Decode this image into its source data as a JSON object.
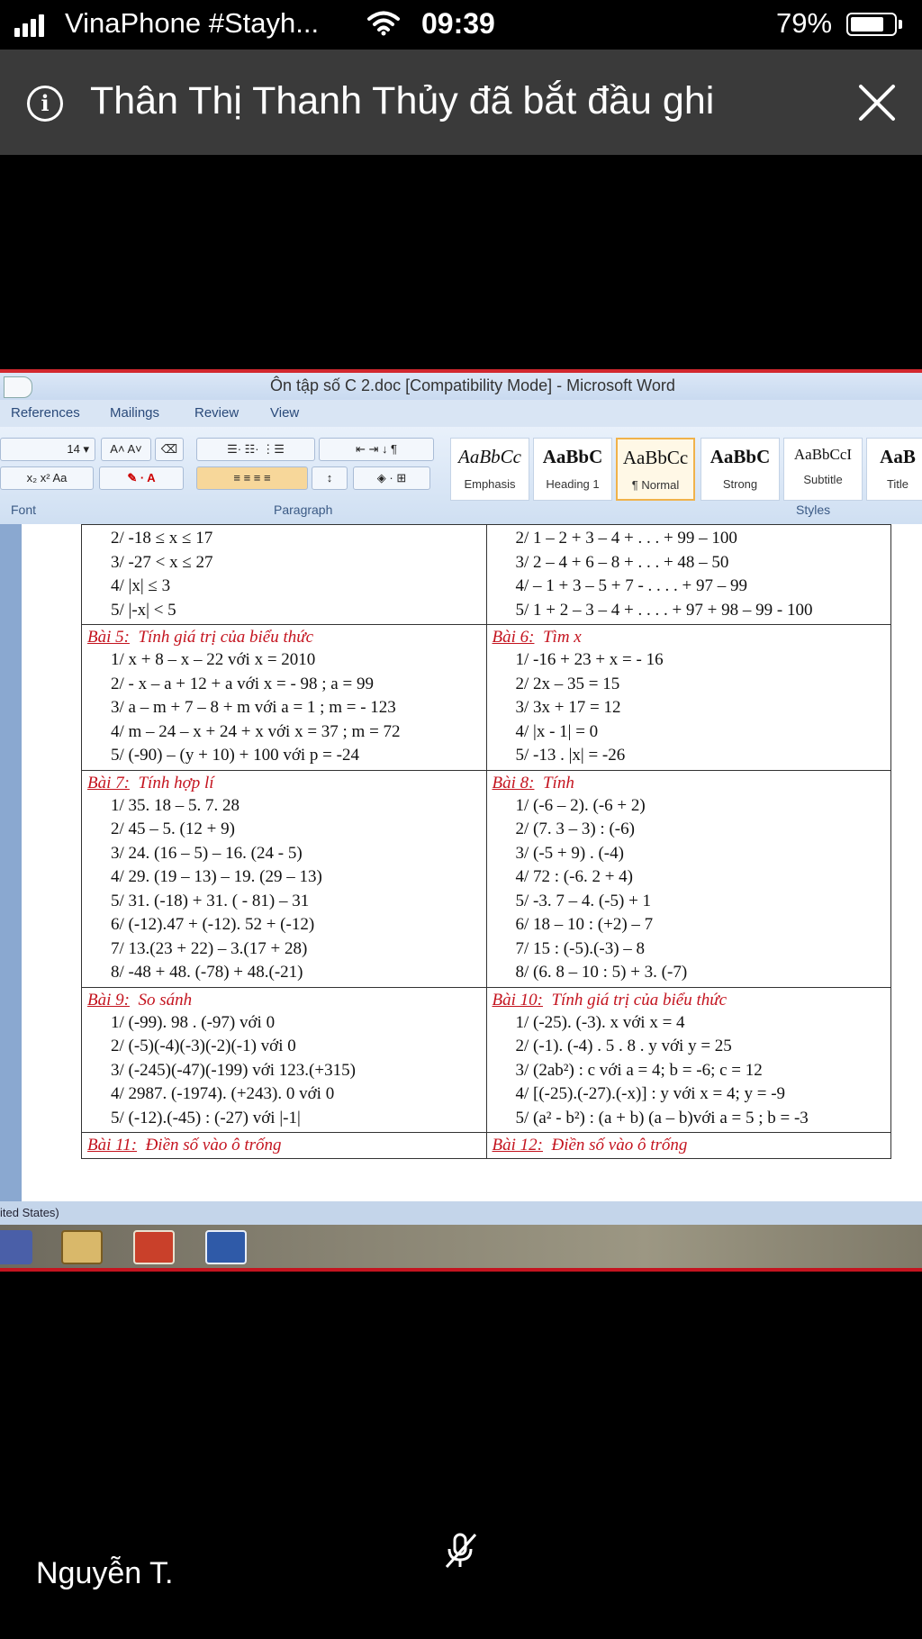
{
  "status_bar": {
    "carrier": "VinaPhone #Stayh...",
    "time": "09:39",
    "battery_percent": "79%",
    "battery_level": 0.79,
    "signal_icon": "signal-bars-icon",
    "wifi_icon": "wifi-icon"
  },
  "banner": {
    "text": "Thân Thị Thanh Thủy đã bắt đầu ghi",
    "info_icon": "info-icon",
    "close_icon": "close-icon"
  },
  "word": {
    "title": "Ôn tập số  C 2.doc [Compatibility Mode] - Microsoft Word",
    "tabs": [
      "References",
      "Mailings",
      "Review",
      "View"
    ],
    "font_size": "14",
    "group_labels": {
      "font": "Font",
      "paragraph": "Paragraph",
      "styles": "Styles"
    },
    "styles": [
      {
        "sample": "AaBbCc",
        "name": "Emphasis"
      },
      {
        "sample": "AaBbC",
        "name": "Heading 1"
      },
      {
        "sample": "AaBbCc",
        "name": "¶ Normal"
      },
      {
        "sample": "AaBbC",
        "name": "Strong"
      },
      {
        "sample": "AaBbCcI",
        "name": "Subtitle"
      },
      {
        "sample": "AaB",
        "name": "Title"
      }
    ],
    "statusline": "ited States)"
  },
  "document": {
    "rows": [
      {
        "left": {
          "title_num": "",
          "title_text": "",
          "lines": [
            "2/  -18 ≤ x ≤ 17",
            "3/  -27 < x ≤ 27",
            "4/  |x| ≤ 3",
            "5/  |-x| < 5"
          ]
        },
        "right": {
          "title_num": "",
          "title_text": "",
          "lines": [
            "2/  1 – 2 + 3 – 4 + . . . + 99 – 100",
            "3/  2 – 4 + 6 – 8 + . . . + 48 – 50",
            "4/  – 1 + 3 – 5 + 7 - . . . . + 97 – 99",
            "5/  1 + 2 – 3 – 4 + . . . . + 97 + 98 – 99 - 100"
          ]
        }
      },
      {
        "left": {
          "title_num": "Bài 5:",
          "title_text": "Tính giá trị của biểu thức",
          "lines": [
            "1/  x + 8 – x – 22            với  x = 2010",
            "2/  - x – a + 12 + a    với  x = - 98  ;  a = 99",
            "3/  a – m + 7 – 8 + m với  a = 1   ; m = - 123",
            "4/  m – 24 – x + 24 + x  với  x = 37 ; m = 72",
            "5/  (-90) – (y + 10) + 100       với    p = -24"
          ]
        },
        "right": {
          "title_num": "Bài 6:",
          "title_text": "Tìm x",
          "lines": [
            "1/  -16 + 23 + x = - 16",
            "2/  2x – 35 = 15",
            "3/  3x + 17 = 12",
            "4/  |x - 1| = 0",
            "5/  -13 . |x|  = -26"
          ]
        }
      },
      {
        "left": {
          "title_num": "Bài 7:",
          "title_text": "Tính hợp lí",
          "lines": [
            "1/  35. 18 – 5. 7. 28",
            "2/  45 – 5. (12 + 9)",
            "3/  24. (16 – 5) – 16. (24 - 5)",
            "4/  29. (19 – 13) – 19. (29 – 13)",
            "5/  31. (-18) + 31. ( - 81) – 31",
            "6/  (-12).47 + (-12). 52 + (-12)",
            "7/  13.(23 + 22) – 3.(17 + 28)",
            "8/  -48 + 48. (-78) + 48.(-21)"
          ]
        },
        "right": {
          "title_num": "Bài 8:",
          "title_text": "Tính",
          "lines": [
            "1/  (-6 – 2). (-6 + 2)",
            "2/  (7. 3 – 3) : (-6)",
            "3/  (-5 + 9) . (-4)",
            "4/  72 : (-6. 2 + 4)",
            "5/  -3. 7 – 4. (-5) + 1",
            "6/  18 – 10 : (+2) – 7",
            "7/  15 : (-5).(-3) – 8",
            "8/  (6. 8 – 10 : 5) + 3. (-7)"
          ]
        }
      },
      {
        "left": {
          "title_num": "Bài 9:",
          "title_text": "So sánh",
          "lines": [
            "1/  (-99). 98 . (-97)                     với 0",
            "2/  (-5)(-4)(-3)(-2)(-1)                 với 0",
            "3/  (-245)(-47)(-199)      với 123.(+315)",
            "4/  2987. (-1974). (+243). 0      với  0",
            "5/  (-12).(-45) : (-27)                 với  |-1|"
          ]
        },
        "right": {
          "title_num": "Bài 10:",
          "title_text": "Tính giá trị của biểu thức",
          "lines": [
            "1/  (-25). (-3). x           với  x = 4",
            "2/  (-1). (-4) . 5 . 8 . y    với  y = 25",
            "3/  (2ab²) : c    với a = 4; b = -6;  c = 12",
            "4/  [(-25).(-27).(-x)] : y  với x = 4;  y = -9",
            "5/  (a² - b²) : (a + b)  (a – b)với a = 5 ; b = -3"
          ]
        }
      },
      {
        "left": {
          "title_num": "Bài 11:",
          "title_text": "Điền số vào ô trống",
          "lines": []
        },
        "right": {
          "title_num": "Bài 12:",
          "title_text": "Điền số vào ô trống",
          "lines": []
        }
      }
    ]
  },
  "call": {
    "participant_name": "Nguyễn T.",
    "mic_icon": "mic-muted-icon"
  }
}
